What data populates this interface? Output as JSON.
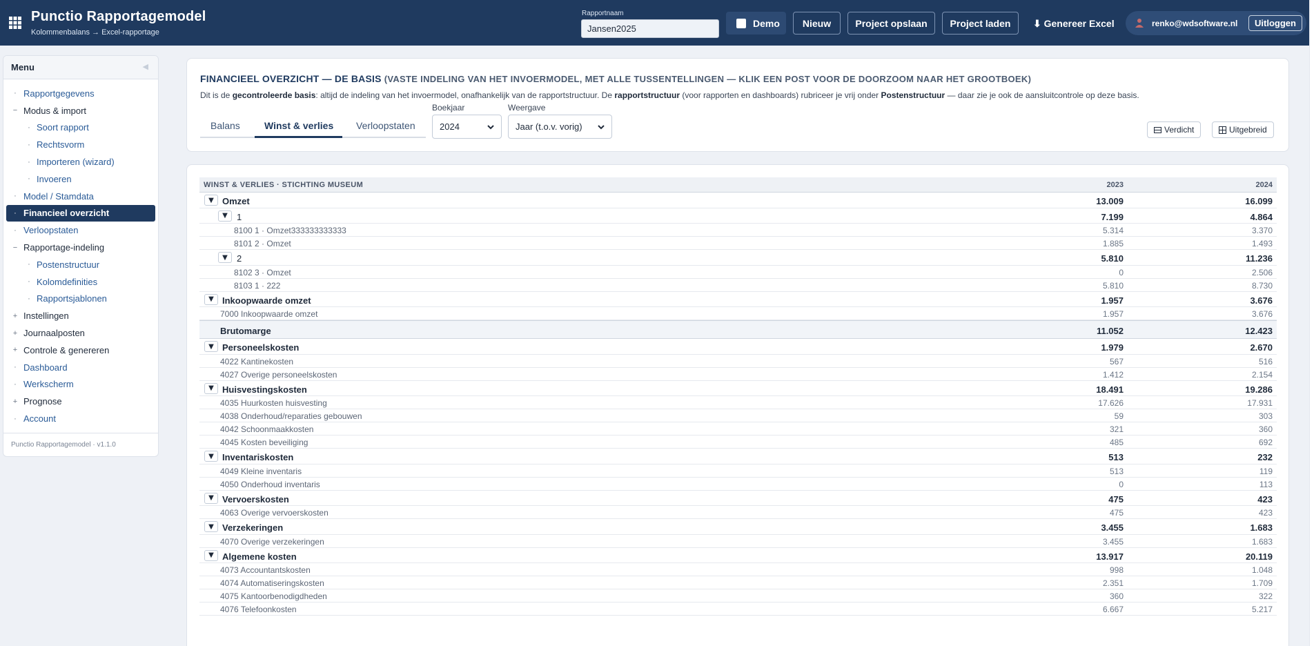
{
  "header": {
    "app_title": "Punctio Rapportagemodel",
    "app_subtitle": "Kolommenbalans → Excel-rapportage",
    "rapport_label": "Rapportnaam",
    "rapport_value": "Jansen2025",
    "demo_label": "Demo",
    "new_label": "Nieuw",
    "save_label": "Project opslaan",
    "load_label": "Project laden",
    "excel_label": "⬇ Genereer Excel",
    "user_email": "renko@wdsoftware.nl",
    "logout_label": "Uitloggen"
  },
  "sidebar": {
    "title": "Menu",
    "collapse_glyph": "◀",
    "items": [
      {
        "label": "Rapportgegevens",
        "marker": "·"
      },
      {
        "label": "Modus & import",
        "marker": "−"
      },
      {
        "label": "Soort rapport",
        "marker": "·"
      },
      {
        "label": "Rechtsvorm",
        "marker": "·"
      },
      {
        "label": "Importeren (wizard)",
        "marker": "·"
      },
      {
        "label": "Invoeren",
        "marker": "·"
      },
      {
        "label": "Model / Stamdata",
        "marker": "·"
      },
      {
        "label": "Financieel overzicht",
        "marker": "·"
      },
      {
        "label": "Verloopstaten",
        "marker": "·"
      },
      {
        "label": "Rapportage-indeling",
        "marker": "−"
      },
      {
        "label": "Postenstructuur",
        "marker": "·"
      },
      {
        "label": "Kolomdefinities",
        "marker": "·"
      },
      {
        "label": "Rapportsjablonen",
        "marker": "·"
      },
      {
        "label": "Instellingen",
        "marker": "+"
      },
      {
        "label": "Journaalposten",
        "marker": "+"
      },
      {
        "label": "Controle & genereren",
        "marker": "+"
      },
      {
        "label": "Dashboard",
        "marker": "·"
      },
      {
        "label": "Werkscherm",
        "marker": "·"
      },
      {
        "label": "Prognose",
        "marker": "+"
      },
      {
        "label": "Account",
        "marker": "·"
      }
    ],
    "footer": "Punctio Rapportagemodel · v1.1.0"
  },
  "overview": {
    "title": "FINANCIEEL OVERZICHT — DE BASIS",
    "title_suffix": "(VASTE INDELING VAN HET INVOERMODEL, MET ALLE TUSSENTELLINGEN — KLIK EEN POST VOOR DE DOORZOOM NAAR HET GROOTBOEK)",
    "intro": {
      "p1": "Dit is de ",
      "b1": "gecontroleerde basis",
      "p2": ": altijd de indeling van het invoermodel, onafhankelijk van de rapportstructuur. De ",
      "b2": "rapportstructuur",
      "p3": " (voor rapporten en dashboards) rubriceer je vrij onder ",
      "b3": "Postenstructuur",
      "p4": " — daar zie je ook de aansluitcontrole op deze basis."
    },
    "tabs": [
      "Balans",
      "Winst & verlies",
      "Verloopstaten"
    ],
    "boekjaar_label": "Boekjaar",
    "boekjaar_value": "2024",
    "weergave_label": "Weergave",
    "weergave_value": "Jaar (t.o.v. vorig)",
    "verdicht_label": "Verdicht",
    "uitgebreid_label": "Uitgebreid"
  },
  "table": {
    "title": "WINST & VERLIES · STICHTING MUSEUM",
    "columns": [
      "2023",
      "2024"
    ],
    "toggle_glyph": "▼",
    "rows": [
      {
        "kind": "group",
        "label": "Omzet",
        "v1": "13.009",
        "v2": "16.099"
      },
      {
        "kind": "sub",
        "label": "1",
        "v1": "7.199",
        "v2": "4.864"
      },
      {
        "kind": "acc-deep",
        "label": "8100 1 · Omzet333333333333",
        "v1": "5.314",
        "v2": "3.370"
      },
      {
        "kind": "acc-deep",
        "label": "8101 2 · Omzet",
        "v1": "1.885",
        "v2": "1.493"
      },
      {
        "kind": "sub",
        "label": "2",
        "v1": "5.810",
        "v2": "11.236"
      },
      {
        "kind": "acc-deep",
        "label": "8102 3 · Omzet",
        "v1": "0",
        "v2": "2.506"
      },
      {
        "kind": "acc-deep",
        "label": "8103 1 · 222",
        "v1": "5.810",
        "v2": "8.730"
      },
      {
        "kind": "group",
        "label": "Inkoopwaarde omzet",
        "v1": "1.957",
        "v2": "3.676"
      },
      {
        "kind": "acc",
        "label": "7000 Inkoopwaarde omzet",
        "v1": "1.957",
        "v2": "3.676"
      },
      {
        "kind": "total",
        "label": "Brutomarge",
        "v1": "11.052",
        "v2": "12.423"
      },
      {
        "kind": "group",
        "label": "Personeelskosten",
        "v1": "1.979",
        "v2": "2.670"
      },
      {
        "kind": "acc",
        "label": "4022 Kantinekosten",
        "v1": "567",
        "v2": "516"
      },
      {
        "kind": "acc",
        "label": "4027 Overige personeelskosten",
        "v1": "1.412",
        "v2": "2.154"
      },
      {
        "kind": "group",
        "label": "Huisvestingskosten",
        "v1": "18.491",
        "v2": "19.286"
      },
      {
        "kind": "acc",
        "label": "4035 Huurkosten huisvesting",
        "v1": "17.626",
        "v2": "17.931"
      },
      {
        "kind": "acc",
        "label": "4038 Onderhoud/reparaties gebouwen",
        "v1": "59",
        "v2": "303"
      },
      {
        "kind": "acc",
        "label": "4042 Schoonmaakkosten",
        "v1": "321",
        "v2": "360"
      },
      {
        "kind": "acc",
        "label": "4045 Kosten beveiliging",
        "v1": "485",
        "v2": "692"
      },
      {
        "kind": "group",
        "label": "Inventariskosten",
        "v1": "513",
        "v2": "232"
      },
      {
        "kind": "acc",
        "label": "4049 Kleine inventaris",
        "v1": "513",
        "v2": "119"
      },
      {
        "kind": "acc",
        "label": "4050 Onderhoud inventaris",
        "v1": "0",
        "v2": "113"
      },
      {
        "kind": "group",
        "label": "Vervoerskosten",
        "v1": "475",
        "v2": "423"
      },
      {
        "kind": "acc",
        "label": "4063 Overige vervoerskosten",
        "v1": "475",
        "v2": "423"
      },
      {
        "kind": "group",
        "label": "Verzekeringen",
        "v1": "3.455",
        "v2": "1.683"
      },
      {
        "kind": "acc",
        "label": "4070 Overige verzekeringen",
        "v1": "3.455",
        "v2": "1.683"
      },
      {
        "kind": "group",
        "label": "Algemene kosten",
        "v1": "13.917",
        "v2": "20.119"
      },
      {
        "kind": "acc",
        "label": "4073 Accountantskosten",
        "v1": "998",
        "v2": "1.048"
      },
      {
        "kind": "acc",
        "label": "4074 Automatiseringskosten",
        "v1": "2.351",
        "v2": "1.709"
      },
      {
        "kind": "acc",
        "label": "4075 Kantoorbenodigdheden",
        "v1": "360",
        "v2": "322"
      },
      {
        "kind": "acc",
        "label": "4076 Telefoonkosten",
        "v1": "6.667",
        "v2": "5.217"
      }
    ]
  }
}
